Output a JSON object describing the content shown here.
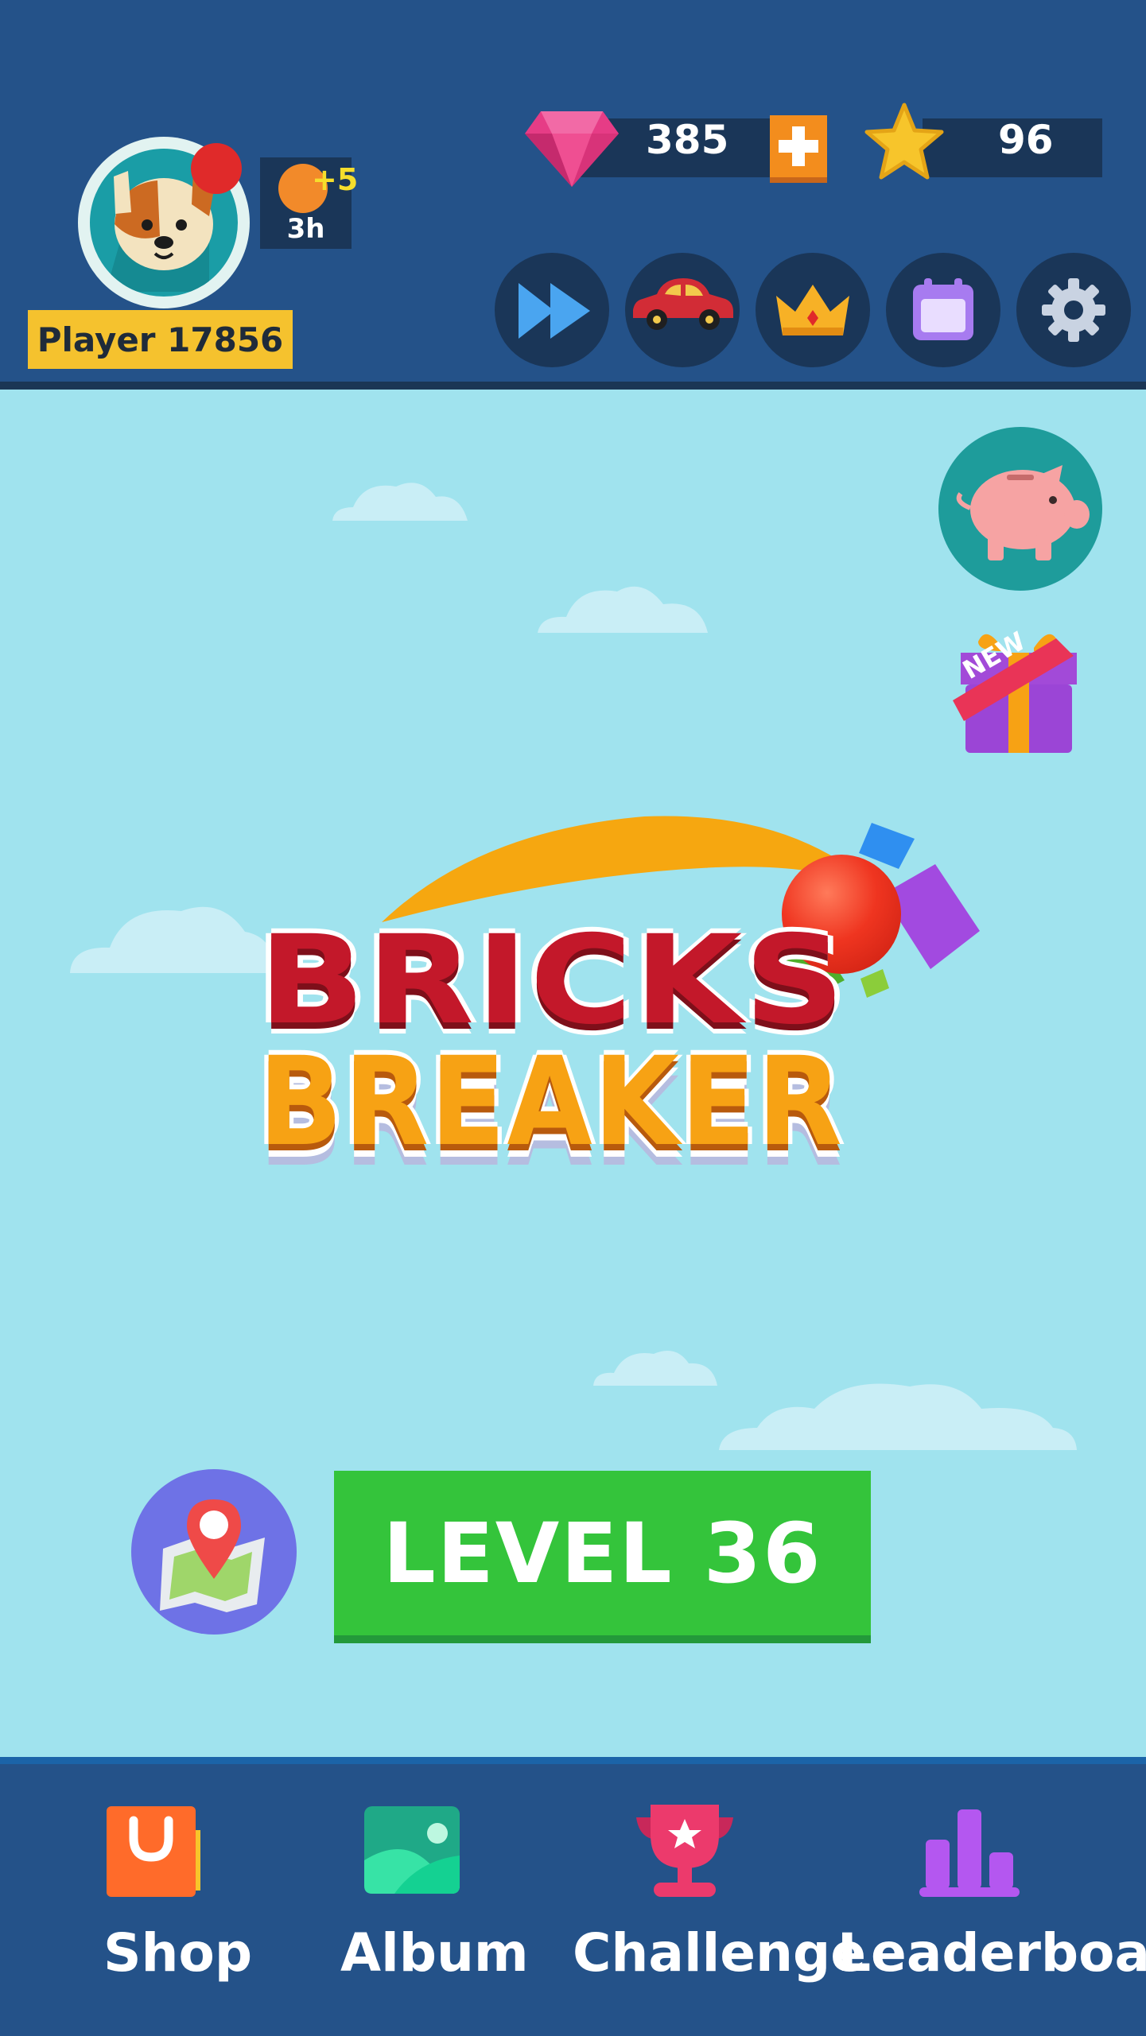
{
  "profile": {
    "player_name": "Player 17856",
    "avatar": "dog-avatar-icon",
    "energy": {
      "bonus": "+5",
      "timer": "3h"
    }
  },
  "currencies": {
    "gems": "385",
    "stars": "96"
  },
  "toolbar_icons": [
    "fast-forward-icon",
    "car-icon",
    "crown-icon",
    "calendar-icon",
    "gear-icon"
  ],
  "side_icons": {
    "piggy": "piggy-bank-icon",
    "gift_badge": "NEW"
  },
  "logo": {
    "line1": "BRICKS",
    "line2": "BREAKER"
  },
  "play": {
    "level_label": "LEVEL 36"
  },
  "bottom_nav": {
    "items": [
      {
        "label": "Shop",
        "icon": "shopping-bag-icon"
      },
      {
        "label": "Album",
        "icon": "album-icon"
      },
      {
        "label": "Challenge",
        "icon": "trophy-icon"
      },
      {
        "label": "Leaderboard",
        "icon": "leaderboard-icon"
      }
    ]
  },
  "colors": {
    "header_bg": "#245289",
    "sky_bg": "#a0e3ee",
    "level_button": "#34c43b",
    "name_badge": "#f5c22e",
    "gem": "#e63c86",
    "star": "#f7c52b"
  }
}
